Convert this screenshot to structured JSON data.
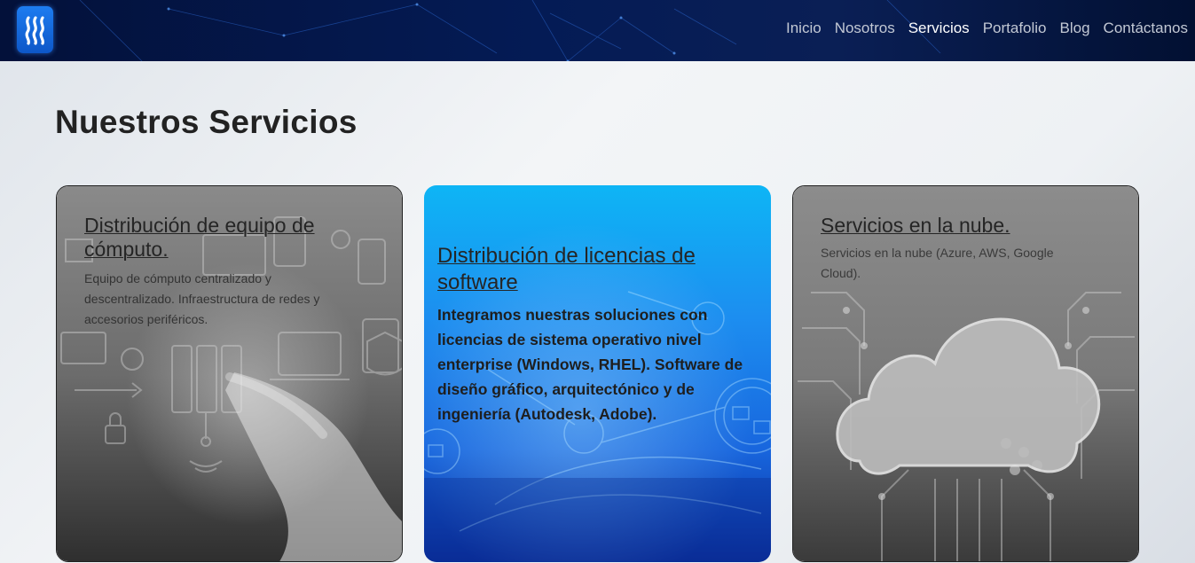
{
  "header": {
    "logo_icon": "steem-logo-icon",
    "nav": [
      {
        "label": "Inicio",
        "active": false
      },
      {
        "label": "Nosotros",
        "active": false
      },
      {
        "label": "Servicios",
        "active": true
      },
      {
        "label": "Portafolio",
        "active": false
      },
      {
        "label": "Blog",
        "active": false
      },
      {
        "label": "Contáctanos",
        "active": false
      }
    ],
    "accent_color": "#041b55"
  },
  "main": {
    "title": "Nuestros Servicios",
    "cards": [
      {
        "title": "Distribución de equipo de cómputo.",
        "description": "Equipo de cómputo centralizado y descentralizado. Infraestructura de redes y accesorios periféricos.",
        "image": "tech-icons-hand-image"
      },
      {
        "title": "Distribución de licencias de software",
        "description": "Integramos nuestras soluciones con licencias de sistema operativo nivel enterprise (Windows, RHEL). Software de diseño gráfico, arquitectónico y de ingeniería (Autodesk, Adobe).",
        "image": "blue-network-image"
      },
      {
        "title": "Servicios en la nube.",
        "description": "Servicios en la nube (Azure, AWS, Google Cloud).",
        "image": "cloud-circuit-image"
      }
    ]
  }
}
